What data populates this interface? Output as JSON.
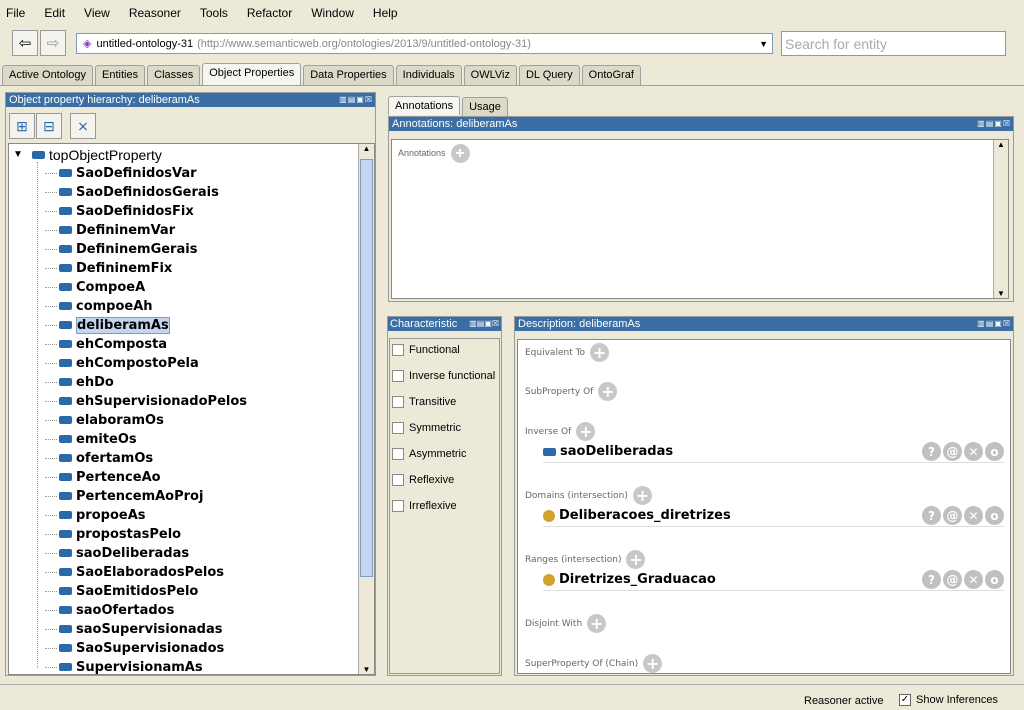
{
  "menu": [
    "File",
    "Edit",
    "View",
    "Reasoner",
    "Tools",
    "Refactor",
    "Window",
    "Help"
  ],
  "nav": {
    "back": "⇦",
    "forward": "⇨"
  },
  "ontology": {
    "name": "untitled-ontology-31",
    "iri": "(http://www.semanticweb.org/ontologies/2013/9/untitled-ontology-31)"
  },
  "search": {
    "placeholder": "Search for entity"
  },
  "tabs": [
    "Active Ontology",
    "Entities",
    "Classes",
    "Object Properties",
    "Data Properties",
    "Individuals",
    "OWLViz",
    "DL Query",
    "OntoGraf"
  ],
  "active_tab": "Object Properties",
  "hierarchy": {
    "title": "Object property hierarchy: deliberamAs",
    "root": "topObjectProperty",
    "selected": "deliberamAs",
    "items": [
      "SaoDefinidosVar",
      "SaoDefinidosGerais",
      "SaoDefinidosFix",
      "DefininemVar",
      "DefininemGerais",
      "DefininemFix",
      "CompoeA",
      "compoeAh",
      "deliberamAs",
      "ehComposta",
      "ehCompostoPela",
      "ehDo",
      "ehSupervisionadoPelos",
      "elaboramOs",
      "emiteOs",
      "ofertamOs",
      "PertenceAo",
      "PertencemAoProj",
      "propoeAs",
      "propostasPelo",
      "saoDeliberadas",
      "SaoElaboradosPelos",
      "SaoEmitidosPelo",
      "saoOfertados",
      "saoSupervisionadas",
      "SaoSupervisionados",
      "SupervisionamAs"
    ]
  },
  "right_tabs": [
    "Annotations",
    "Usage"
  ],
  "annotations": {
    "title": "Annotations: deliberamAs",
    "label": "Annotations"
  },
  "characteristics": {
    "title": "Characteristic",
    "items": [
      "Functional",
      "Inverse functional",
      "Transitive",
      "Symmetric",
      "Asymmetric",
      "Reflexive",
      "Irreflexive"
    ]
  },
  "description": {
    "title": "Description: deliberamAs",
    "equivalent": "Equivalent To",
    "subproperty": "SubProperty Of",
    "inverse": "Inverse Of",
    "inverse_value": "saoDeliberadas",
    "domains": "Domains (intersection)",
    "domain_value": "Deliberacoes_diretrizes",
    "ranges": "Ranges (intersection)",
    "range_value": "Diretrizes_Graduacao",
    "disjoint": "Disjoint With",
    "chain": "SuperProperty Of (Chain)"
  },
  "status": {
    "reasoner": "Reasoner active",
    "show_inferences": "Show Inferences",
    "show_inferences_checked": true
  },
  "colors": {
    "header": "#3a6ea5",
    "property": "#2a6aa8",
    "class": "#d4a22a"
  }
}
